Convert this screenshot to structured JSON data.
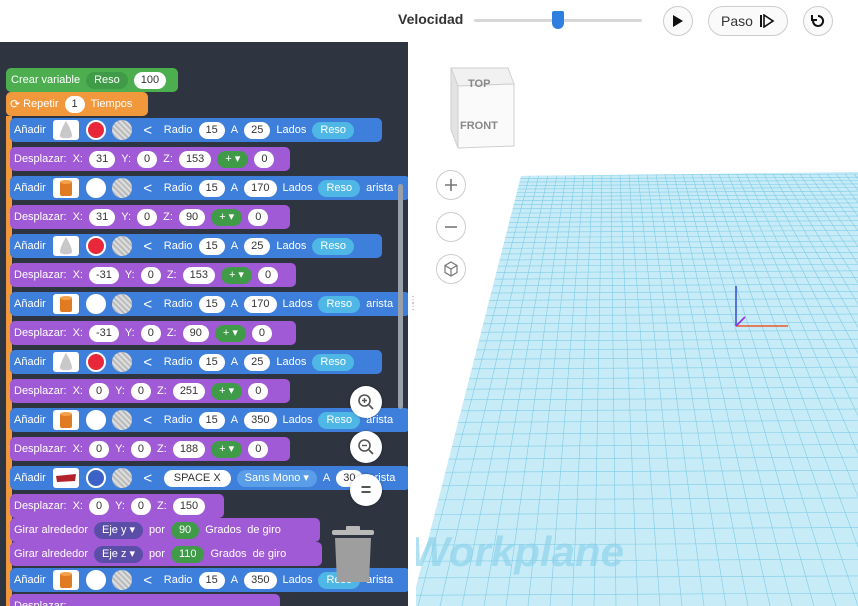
{
  "toolbar": {
    "speed_label": "Velocidad",
    "speed_value": 0.5,
    "step_label": "Paso",
    "play_icon": "play-icon",
    "step_icon": "step-icon",
    "reset_icon": "reset-icon"
  },
  "blocks": {
    "create_var": {
      "label": "Crear variable",
      "var": "Reso",
      "value": "100"
    },
    "repeat": {
      "label": "Repetir",
      "count": "1",
      "unit": "Tiempos"
    },
    "add_label": "Añadir",
    "move_label": "Desplazar:",
    "radius_label": "Radio",
    "a_label": "A",
    "sides_label": "Lados",
    "reso_label": "Reso",
    "arista_label": "arista",
    "rotate_label": "Girar alrededor",
    "by_label": "por",
    "degrees_label": "Grados",
    "of_turn_label": "de giro",
    "adds": [
      {
        "shape": "cone",
        "color": "#e8283a",
        "radio": "15",
        "a": "25"
      },
      {
        "shape": "cylinder",
        "color": "#ffffff",
        "radio": "15",
        "a": "170"
      },
      {
        "shape": "cone",
        "color": "#e8283a",
        "radio": "15",
        "a": "25"
      },
      {
        "shape": "cylinder",
        "color": "#ffffff",
        "radio": "15",
        "a": "170"
      },
      {
        "shape": "cone",
        "color": "#e8283a",
        "radio": "15",
        "a": "25"
      },
      {
        "shape": "cylinder",
        "color": "#ffffff",
        "radio": "15",
        "a": "350"
      }
    ],
    "moves": [
      {
        "x": "31",
        "y": "0",
        "z": "153",
        "op": "+ ▾",
        "extra": "0"
      },
      {
        "x": "31",
        "y": "0",
        "z": "90",
        "op": "+ ▾",
        "extra": "0"
      },
      {
        "x": "-31",
        "y": "0",
        "z": "153",
        "op": "+ ▾",
        "extra": "0"
      },
      {
        "x": "-31",
        "y": "0",
        "z": "90",
        "op": "+ ▾",
        "extra": "0"
      },
      {
        "x": "0",
        "y": "0",
        "z": "251",
        "op": "+ ▾",
        "extra": "0"
      },
      {
        "x": "0",
        "y": "0",
        "z": "188",
        "op": "+ ▾",
        "extra": "0"
      }
    ],
    "text_add": {
      "text": "SPACE X",
      "font": "Sans Mono ▾",
      "a": "30"
    },
    "move_last": {
      "x": "0",
      "y": "0",
      "z": "150"
    },
    "rot1": {
      "axis": "Eje y ▾",
      "deg": "90"
    },
    "rot2": {
      "axis": "Eje z ▾",
      "deg": "110"
    },
    "last_add": {
      "radio": "15",
      "a": "350"
    }
  },
  "viewcube": {
    "top": "TOP",
    "front": "FRONT"
  },
  "workplane_label": "Workplane"
}
